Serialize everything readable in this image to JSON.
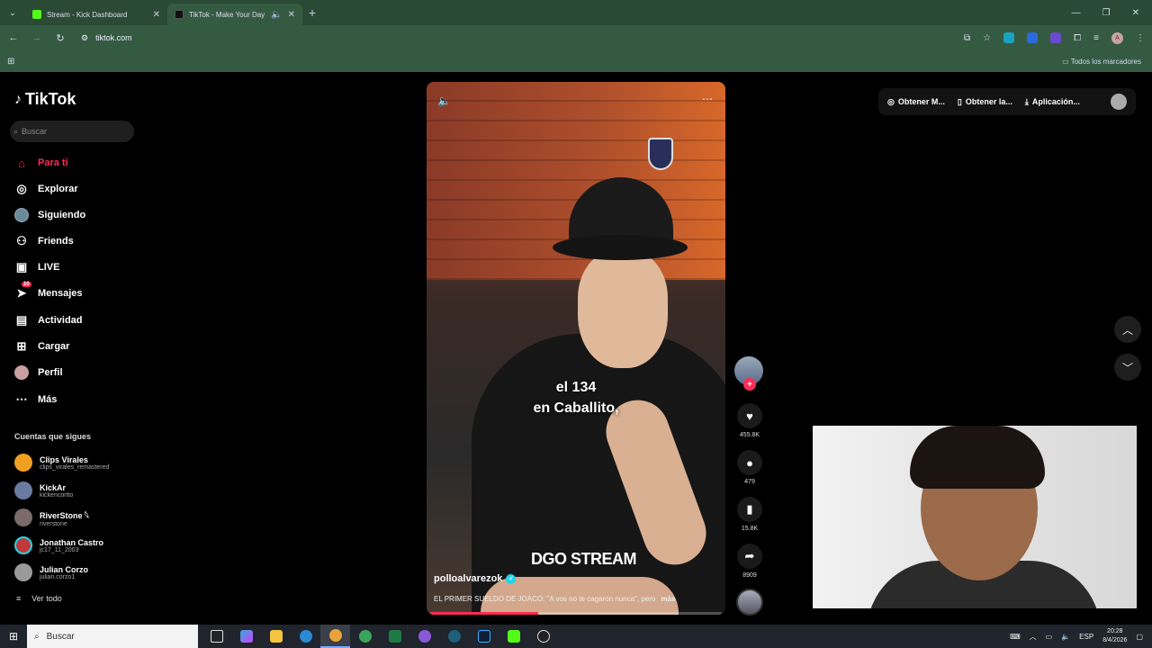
{
  "browser": {
    "tabs": [
      {
        "title": "Stream - Kick Dashboard",
        "favicon_color": "#53fc18",
        "active": false
      },
      {
        "title": "TikTok - Make Your Day",
        "favicon_color": "#000000",
        "active": true
      }
    ],
    "url": "tiktok.com",
    "bookmarks_all": "Todos los marcadores"
  },
  "sidebar": {
    "logo": "TikTok",
    "search_placeholder": "Buscar",
    "nav": [
      {
        "label": "Para ti",
        "icon": "home-icon",
        "active": true
      },
      {
        "label": "Explorar",
        "icon": "compass-icon"
      },
      {
        "label": "Siguiendo",
        "icon": "following-avatar-icon"
      },
      {
        "label": "Friends",
        "icon": "friends-icon"
      },
      {
        "label": "LIVE",
        "icon": "live-icon"
      },
      {
        "label": "Mensajes",
        "icon": "messages-icon",
        "badge": "10"
      },
      {
        "label": "Actividad",
        "icon": "activity-icon"
      },
      {
        "label": "Cargar",
        "icon": "upload-icon"
      },
      {
        "label": "Perfil",
        "icon": "profile-icon"
      },
      {
        "label": "Más",
        "icon": "more-icon"
      }
    ],
    "following_title": "Cuentas que sigues",
    "following": [
      {
        "name": "Clips Virales",
        "handle": "clips_virales_remastered",
        "color": "#f0a020"
      },
      {
        "name": "KickAr",
        "handle": "kickencortto",
        "color": "#6a7aa0"
      },
      {
        "name": "RiverStone 𓆩",
        "handle": "riverstone",
        "color": "#7a6a6a"
      },
      {
        "name": "Jonathan Castro",
        "handle": "jc17_11_2003",
        "color": "#c03a3a"
      },
      {
        "name": "Julian Corzo",
        "handle": "julian.corzo1",
        "color": "#9a9a9a"
      }
    ],
    "see_all": "Ver todo"
  },
  "video": {
    "subtitle_line1": "el 134",
    "subtitle_line2": "en Caballito,",
    "watermark": "DGO STREAM",
    "username": "polloalvarezok",
    "description": "EL PRIMER SUELDO DE JOACO: \"A vos no te cagaron nunca\", pero",
    "more": "más",
    "progress": 0.37
  },
  "actions": {
    "likes": "455.8K",
    "comments": "479",
    "saves": "15.8K",
    "shares": "8909"
  },
  "topbar": {
    "coins": "Obtener M...",
    "app_get": "Obtener la...",
    "app": "Aplicación..."
  },
  "taskbar": {
    "search": "Buscar",
    "lang": "ESP",
    "time": "20:28",
    "date": "8/4/2026"
  }
}
